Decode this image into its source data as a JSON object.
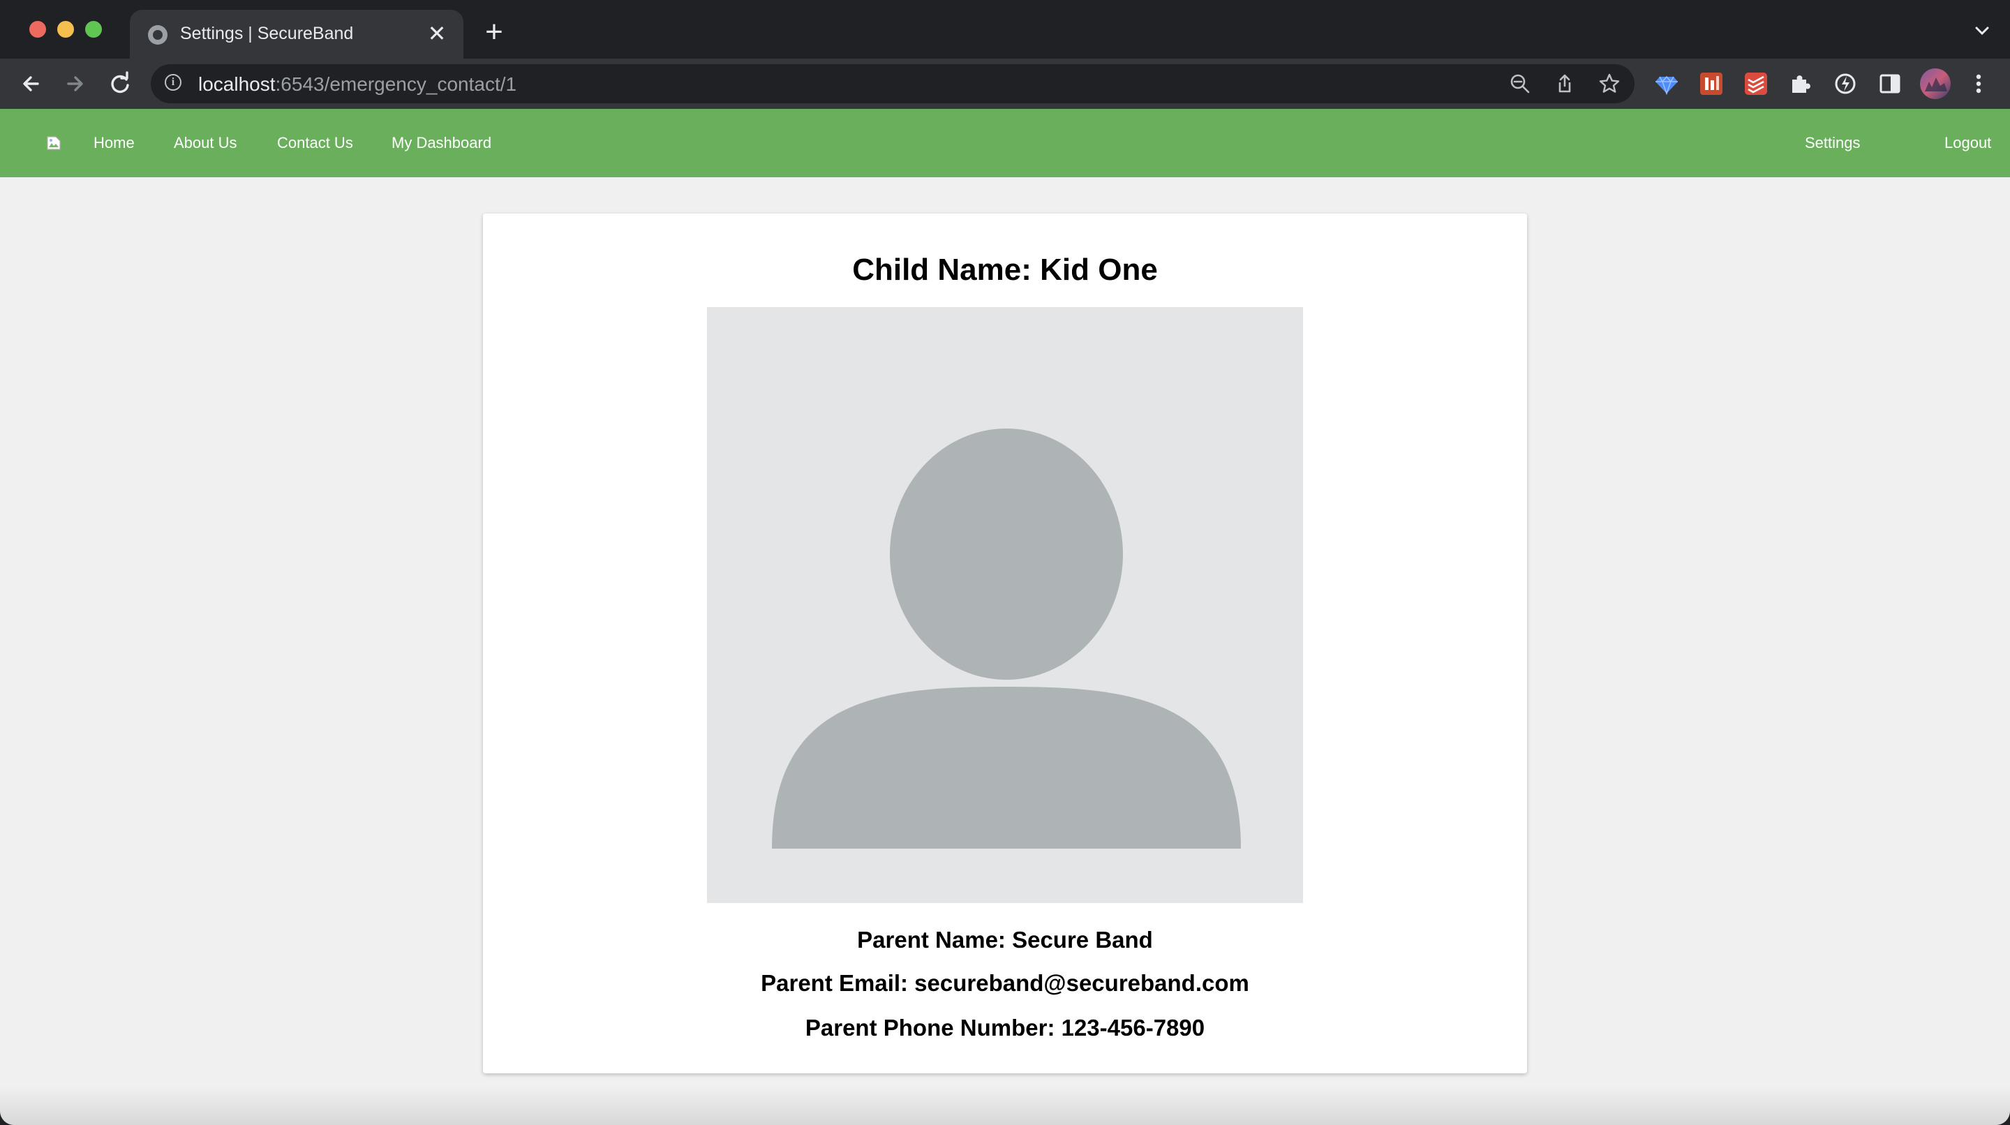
{
  "browser": {
    "tab_title": "Settings | SecureBand",
    "close_glyph": "✕",
    "new_tab_glyph": "+",
    "url_host": "localhost",
    "url_path": ":6543/emergency_contact/1"
  },
  "navbar": {
    "color": "#6ab05c",
    "links": {
      "home": "Home",
      "about": "About Us",
      "contact": "Contact Us",
      "dashboard": "My Dashboard",
      "settings": "Settings",
      "logout": "Logout"
    }
  },
  "profile": {
    "child_name": "Child Name: Kid One",
    "parent_name": "Parent Name: Secure Band",
    "parent_email": "Parent Email: secureband@secureband.com",
    "parent_phone": "Parent Phone Number: 123-456-7890"
  },
  "icons": [
    "globe-icon",
    "close-icon",
    "plus-icon",
    "back-icon",
    "forward-icon",
    "reload-icon",
    "info-icon",
    "zoom-out-icon",
    "share-icon",
    "star-icon",
    "extension-icons",
    "puzzle-icon",
    "sidebar-icon",
    "profile-avatar-icon",
    "more-icon",
    "broken-image-icon",
    "avatar-placeholder-icon"
  ]
}
